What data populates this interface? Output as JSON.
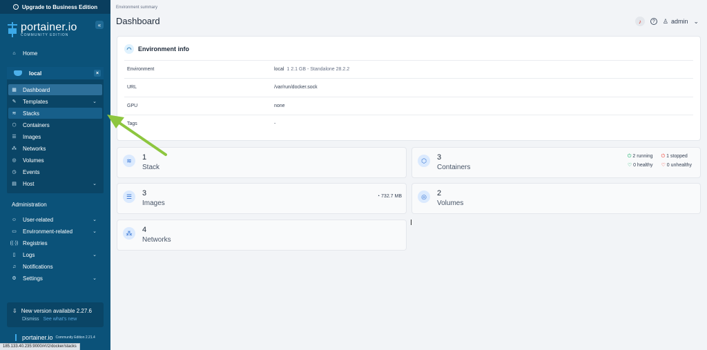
{
  "sidebar": {
    "upgrade_label": "Upgrade to Business Edition",
    "logo_name": "portainer.io",
    "logo_edition": "COMMUNITY EDITION",
    "collapse_icon": "«",
    "home": "Home",
    "env_name": "local",
    "env_close": "×",
    "env_items": [
      {
        "label": "Dashboard"
      },
      {
        "label": "Templates"
      },
      {
        "label": "Stacks"
      },
      {
        "label": "Containers"
      },
      {
        "label": "Images"
      },
      {
        "label": "Networks"
      },
      {
        "label": "Volumes"
      },
      {
        "label": "Events"
      },
      {
        "label": "Host"
      }
    ],
    "admin_heading": "Administration",
    "admin_items": [
      {
        "label": "User-related"
      },
      {
        "label": "Environment-related"
      },
      {
        "label": "Registries"
      },
      {
        "label": "Logs"
      },
      {
        "label": "Notifications"
      },
      {
        "label": "Settings"
      }
    ],
    "update_title": "New version available 2.27.6",
    "update_dismiss": "Dismiss",
    "update_see": "See what's new",
    "footer_name": "portainer.io",
    "footer_version": "Community Edition 2.21.4"
  },
  "statusbar_url": "185.133.40.235:9000/#!/2/docker/stacks",
  "header": {
    "breadcrumb": "Environment summary",
    "title": "Dashboard",
    "user": "admin"
  },
  "env_info": {
    "title": "Environment info",
    "rows": [
      {
        "key": "Environment",
        "value": "local",
        "meta": "1  2.1 GB - Standalone 28.2.2"
      },
      {
        "key": "URL",
        "value": "/var/run/docker.sock",
        "meta": ""
      },
      {
        "key": "GPU",
        "value": "none",
        "meta": ""
      },
      {
        "key": "Tags",
        "value": "-",
        "meta": ""
      }
    ]
  },
  "tiles": {
    "stack": {
      "count": "1",
      "label": "Stack"
    },
    "containers": {
      "count": "3",
      "label": "Containers",
      "running": "2 running",
      "stopped": "1 stopped",
      "healthy": "0 healthy",
      "unhealthy": "0 unhealthy"
    },
    "images": {
      "count": "3",
      "label": "Images",
      "size": "732.7 MB"
    },
    "volumes": {
      "count": "2",
      "label": "Volumes"
    },
    "networks": {
      "count": "4",
      "label": "Networks"
    }
  },
  "colors": {
    "sidebar_bg": "#0b5279",
    "accent_arrow": "#8dc63f"
  }
}
